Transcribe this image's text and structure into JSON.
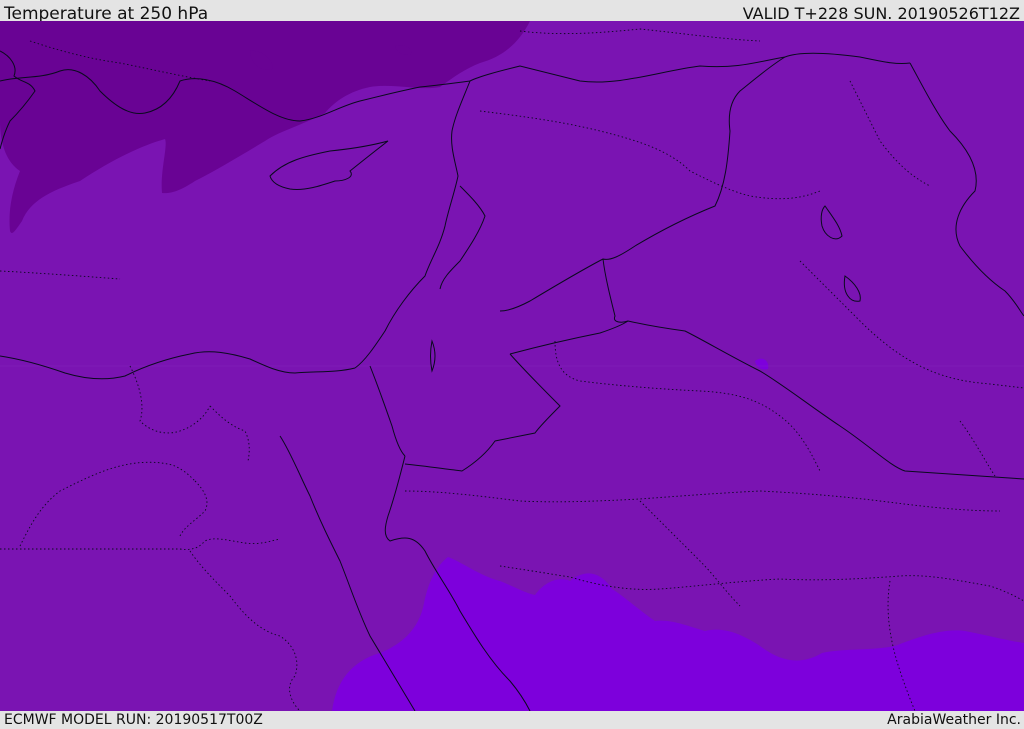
{
  "header": {
    "title": "Temperature at 250 hPa",
    "valid_time": "VALID T+228 SUN. 20190526T12Z"
  },
  "footer": {
    "model_run": "ECMWF MODEL RUN: 20190517T00Z",
    "credit": "ArabiaWeather Inc."
  },
  "map": {
    "colors": {
      "base_purple": "#7a14b2",
      "cold_region": "#690394",
      "warm_region": "#7d00dc"
    }
  }
}
